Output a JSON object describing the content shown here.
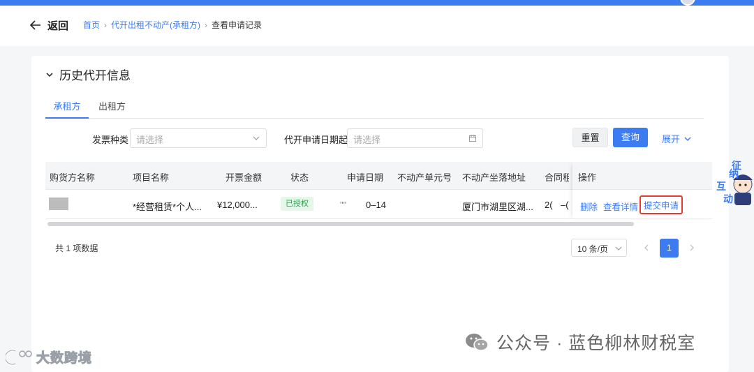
{
  "header": {
    "back_label": "返回",
    "breadcrumbs": [
      "首页",
      "代开出租不动产(承租方)",
      "查看申请记录"
    ]
  },
  "section": {
    "title": "历史代开信息"
  },
  "tabs": [
    {
      "label": "承租方",
      "active": true
    },
    {
      "label": "出租方",
      "active": false
    }
  ],
  "filters": {
    "invoice_type_label": "发票种类",
    "invoice_type_placeholder": "请选择",
    "date_label": "代开申请日期起",
    "date_placeholder": "请选择",
    "reset": "重置",
    "query": "查询",
    "expand": "展开"
  },
  "table": {
    "columns": [
      "购货方名称",
      "项目名称",
      "开票金额",
      "状态",
      "申请日期",
      "不动产单元号",
      "不动产坐落地址",
      "合同租",
      "操作"
    ],
    "rows": [
      {
        "buyer": "",
        "item": "*经营租赁*个人...",
        "amount": "¥12,000...",
        "status": "已授权",
        "date_a": "\"\"",
        "date_b": "0–14",
        "unit_no": "",
        "address": "厦门市湖里区湖...",
        "contract_a": "2(",
        "contract_b": "–(",
        "actions": [
          "删除",
          "查看详情",
          "提交申请"
        ]
      }
    ]
  },
  "pagination": {
    "total_text": "共 1 项数据",
    "page_size": "10 条/页",
    "current_page": "1"
  },
  "side_widget": {
    "text": [
      "纳",
      "征",
      "互",
      "动"
    ]
  },
  "watermarks": {
    "left": "大数跨境",
    "right": "公众号 · 蓝色柳林财税室"
  },
  "colors": {
    "primary": "#3d7bf1",
    "success": "#1fa847",
    "highlight": "#e43d30"
  }
}
